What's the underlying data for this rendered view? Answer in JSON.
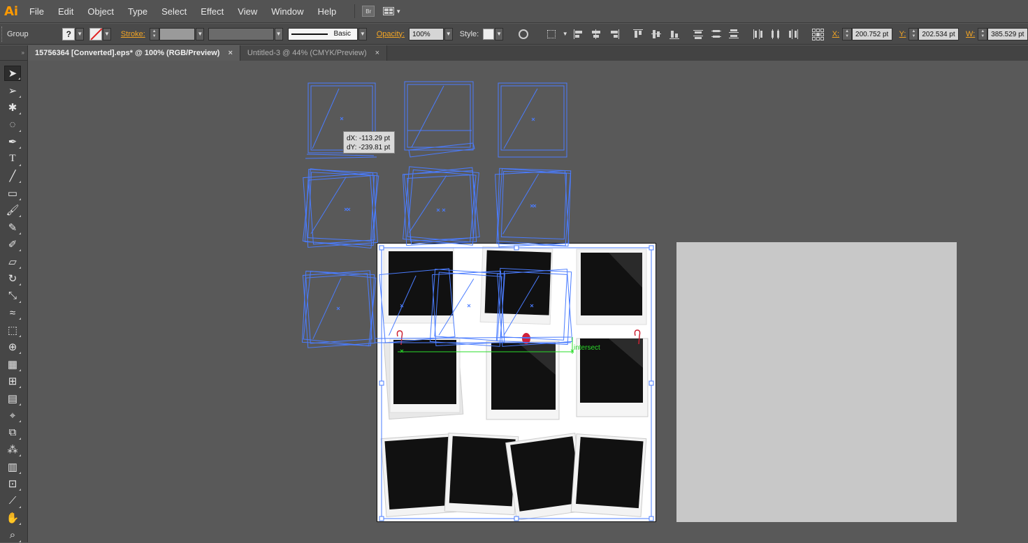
{
  "app": {
    "logo": "Ai"
  },
  "menu": [
    "File",
    "Edit",
    "Object",
    "Type",
    "Select",
    "Effect",
    "View",
    "Window",
    "Help"
  ],
  "menu_extra": {
    "bridge_label": "Br"
  },
  "control": {
    "selection_type": "Group",
    "fill_swatch_label": "?",
    "stroke_label": "Stroke:",
    "brush_label": "Basic",
    "opacity_label": "Opacity:",
    "opacity_value": "100%",
    "style_label": "Style:",
    "x_label": "X:",
    "x_value": "200.752 pt",
    "y_label": "Y:",
    "y_value": "202.534 pt",
    "w_label": "W:",
    "w_value": "385.529 pt"
  },
  "tabs": [
    {
      "title": "15756364 [Converted].eps* @ 100% (RGB/Preview)",
      "close": "×"
    },
    {
      "title": "Untitled-3 @ 44% (CMYK/Preview)",
      "close": "×"
    }
  ],
  "tools": [
    "selection-tool",
    "direct-selection-tool",
    "magic-wand-tool",
    "lasso-tool",
    "pen-tool",
    "type-tool",
    "line-segment-tool",
    "rectangle-tool",
    "paintbrush-tool",
    "pencil-tool",
    "blob-brush-tool",
    "eraser-tool",
    "rotate-tool",
    "scale-tool",
    "warp-tool",
    "free-transform-tool",
    "shape-builder-tool",
    "perspective-grid-tool",
    "mesh-tool",
    "gradient-tool",
    "eyedropper-tool",
    "blend-tool",
    "symbol-sprayer-tool",
    "column-graph-tool",
    "artboard-tool",
    "slice-tool",
    "hand-tool",
    "zoom-tool"
  ],
  "tooltip": {
    "dx": "dX: -113.29 pt",
    "dy": "dY: -239.81 pt"
  },
  "smart_guide_label": "intersect",
  "colors": {
    "selection_blue": "#4a7cff",
    "smart_guide_green": "#2adc2a",
    "accent_orange": "#f5a623",
    "pin_red": "#d0203a"
  }
}
